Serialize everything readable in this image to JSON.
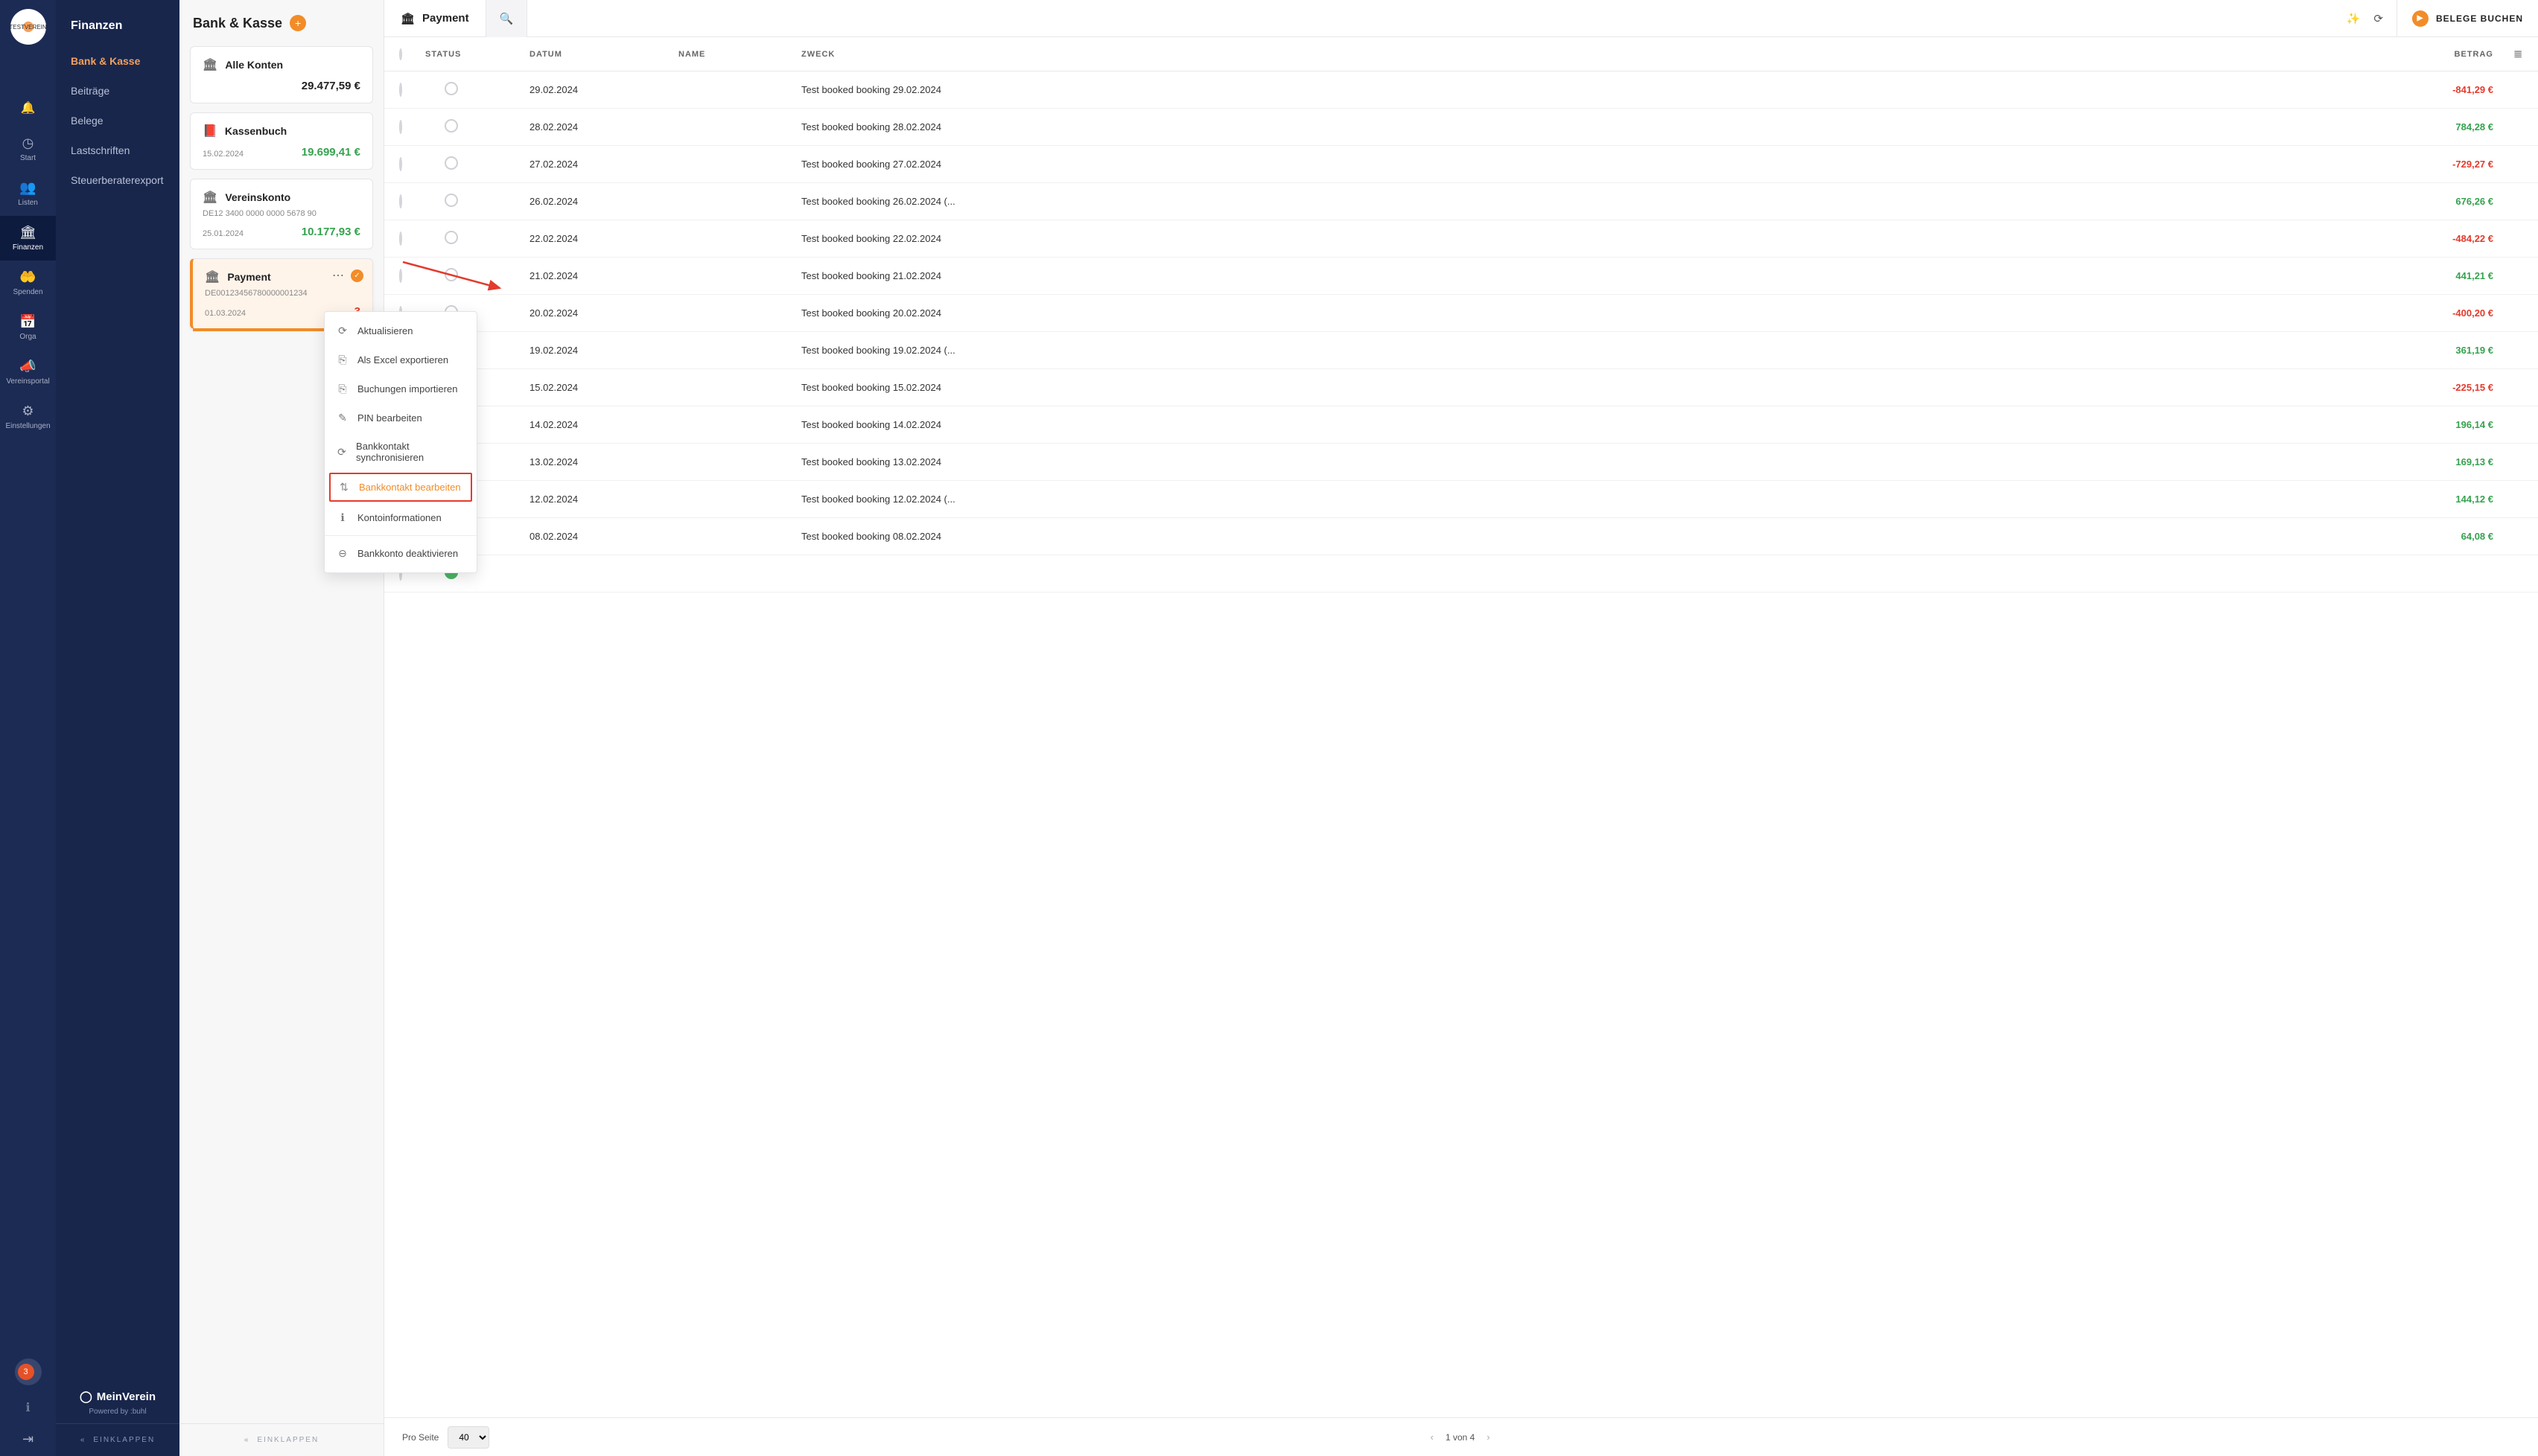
{
  "brand": {
    "logoText": "TESTVEREIN",
    "name": "MeinVerein",
    "poweredBy": "Powered by  :buhl"
  },
  "rail": {
    "badge": "3",
    "items": [
      {
        "id": "start",
        "label": "Start",
        "icon": "◷"
      },
      {
        "id": "listen",
        "label": "Listen",
        "icon": "👥"
      },
      {
        "id": "finanzen",
        "label": "Finanzen",
        "icon": "🏛",
        "active": true
      },
      {
        "id": "spenden",
        "label": "Spenden",
        "icon": "🤲"
      },
      {
        "id": "orga",
        "label": "Orga",
        "icon": "📅"
      },
      {
        "id": "vereinsportal",
        "label": "Vereinsportal",
        "icon": "📣"
      },
      {
        "id": "einstellungen",
        "label": "Einstellungen",
        "icon": "⚙"
      }
    ]
  },
  "sidenav": {
    "title": "Finanzen",
    "items": [
      "Bank & Kasse",
      "Beiträge",
      "Belege",
      "Lastschriften",
      "Steuerberaterexport"
    ],
    "activeIndex": 0,
    "collapse": "EINKLAPPEN"
  },
  "accounts": {
    "title": "Bank & Kasse",
    "collapse": "EINKLAPPEN",
    "cards": [
      {
        "icon": "🏛",
        "name": "Alle Konten",
        "sub": "",
        "date": "",
        "amount": "29.477,59 €",
        "sign": "neu"
      },
      {
        "icon": "📕",
        "name": "Kassenbuch",
        "sub": "",
        "date": "15.02.2024",
        "amount": "19.699,41 €",
        "sign": "pos"
      },
      {
        "icon": "🏛",
        "name": "Vereinskonto",
        "sub": "DE12 3400 0000 0000 5678 90",
        "date": "25.01.2024",
        "amount": "10.177,93 €",
        "sign": "pos"
      },
      {
        "icon": "🏛",
        "name": "Payment",
        "sub": "DE00123456780000001234",
        "date": "01.03.2024",
        "amount": "-3",
        "sign": "neg",
        "selected": true,
        "showActions": true
      }
    ]
  },
  "ctxmenu": {
    "items": [
      {
        "icon": "⟳",
        "label": "Aktualisieren"
      },
      {
        "icon": "⎘",
        "label": "Als Excel exportieren"
      },
      {
        "icon": "⎘",
        "label": "Buchungen importieren"
      },
      {
        "icon": "✎",
        "label": "PIN bearbeiten"
      },
      {
        "icon": "⟳",
        "label": "Bankkontakt synchronisieren"
      },
      {
        "icon": "⇅",
        "label": "Bankkontakt bearbeiten",
        "highlight": true
      },
      {
        "icon": "ℹ",
        "label": "Kontoinformationen"
      },
      {
        "sep": true
      },
      {
        "icon": "⊖",
        "label": "Bankkonto deaktivieren"
      }
    ]
  },
  "main": {
    "tabTitle": "Payment",
    "bookBtn": "BELEGE BUCHEN",
    "columns": {
      "status": "STATUS",
      "date": "DATUM",
      "name": "NAME",
      "purpose": "ZWECK",
      "amount": "BETRAG"
    },
    "rows": [
      {
        "date": "29.02.2024",
        "purpose": "Test booked booking 29.02.2024",
        "amount": "-841,29 €",
        "sign": "neg"
      },
      {
        "date": "28.02.2024",
        "purpose": "Test booked booking 28.02.2024",
        "amount": "784,28 €",
        "sign": "pos"
      },
      {
        "date": "27.02.2024",
        "purpose": "Test booked booking 27.02.2024",
        "amount": "-729,27 €",
        "sign": "neg"
      },
      {
        "date": "26.02.2024",
        "purpose": "Test booked booking 26.02.2024 (...",
        "amount": "676,26 €",
        "sign": "pos"
      },
      {
        "date": "22.02.2024",
        "purpose": "Test booked booking 22.02.2024",
        "amount": "-484,22 €",
        "sign": "neg"
      },
      {
        "date": "21.02.2024",
        "purpose": "Test booked booking 21.02.2024",
        "amount": "441,21 €",
        "sign": "pos"
      },
      {
        "date": "20.02.2024",
        "purpose": "Test booked booking 20.02.2024",
        "amount": "-400,20 €",
        "sign": "neg"
      },
      {
        "date": "19.02.2024",
        "purpose": "Test booked booking 19.02.2024 (...",
        "amount": "361,19 €",
        "sign": "pos"
      },
      {
        "date": "15.02.2024",
        "purpose": "Test booked booking 15.02.2024",
        "amount": "-225,15 €",
        "sign": "neg"
      },
      {
        "date": "14.02.2024",
        "purpose": "Test booked booking 14.02.2024",
        "amount": "196,14 €",
        "sign": "pos"
      },
      {
        "date": "13.02.2024",
        "purpose": "Test booked booking 13.02.2024",
        "amount": "169,13 €",
        "sign": "pos"
      },
      {
        "date": "12.02.2024",
        "purpose": "Test booked booking 12.02.2024 (...",
        "amount": "144,12 €",
        "sign": "pos"
      },
      {
        "date": "08.02.2024",
        "purpose": "Test booked booking 08.02.2024",
        "amount": "64,08 €",
        "sign": "pos"
      },
      {
        "date": "",
        "purpose": "",
        "amount": "",
        "sign": "pos",
        "green": true
      }
    ],
    "pager": {
      "perPageLabel": "Pro Seite",
      "perPage": "40",
      "pageText": "1 von 4"
    }
  }
}
